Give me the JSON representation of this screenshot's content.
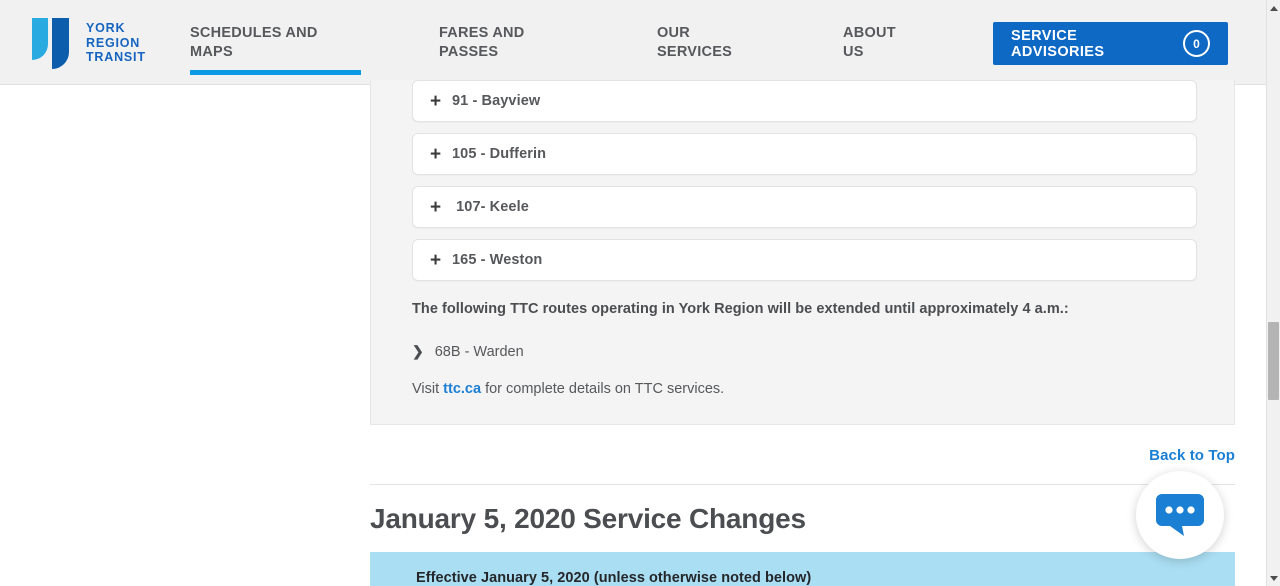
{
  "header": {
    "logo": {
      "icon": "york-region-transit-logo",
      "text": "YORK\nREGION\nTRANSIT",
      "color_light": "#29abe2",
      "color_dark": "#0d5dad"
    },
    "nav_items": [
      {
        "label": "SCHEDULES AND\nMAPS",
        "active": true
      },
      {
        "label": "FARES AND\nPASSES",
        "active": false
      },
      {
        "label": "OUR\nSERVICES",
        "active": false
      },
      {
        "label": "ABOUT\nUS",
        "active": false
      }
    ],
    "advisories": {
      "label": "SERVICE ADVISORIES",
      "count": "0",
      "bg_color": "#0e69c5"
    },
    "active_underline_color": "#0d9ae5"
  },
  "panel": {
    "routes": [
      {
        "expand_icon": "plus-icon",
        "label": "91 - Bayview"
      },
      {
        "expand_icon": "plus-icon",
        "label": "105 - Dufferin"
      },
      {
        "expand_icon": "plus-icon",
        "label": " 107- Keele"
      },
      {
        "expand_icon": "plus-icon",
        "label": "165 - Weston"
      }
    ],
    "note": "The following TTC routes operating in York Region will be extended until approximately 4 a.m.:",
    "bullet": {
      "arrow_icon": "chevron-right-icon",
      "text": "68B - Warden"
    },
    "visit": {
      "prefix": "Visit ",
      "link": "ttc.ca",
      "suffix": " for complete details on TTC services.",
      "link_color": "#1b7fd4"
    }
  },
  "back_to_top": {
    "label": "Back to Top",
    "color": "#1b7fd4"
  },
  "section": {
    "title": "January 5, 2020 Service Changes",
    "effective_banner": {
      "text": "Effective January 5, 2020 (unless otherwise noted below)",
      "bg_color": "#aadef2"
    }
  },
  "chat_widget": {
    "icon": "chat-bubble-icon",
    "bubble_color": "#1b7fd4",
    "dots": 3
  },
  "scrollbar": {
    "up_icon": "scroll-up-arrow-icon",
    "down_icon": "scroll-down-arrow-icon",
    "thumb": "scrollbar-thumb"
  }
}
